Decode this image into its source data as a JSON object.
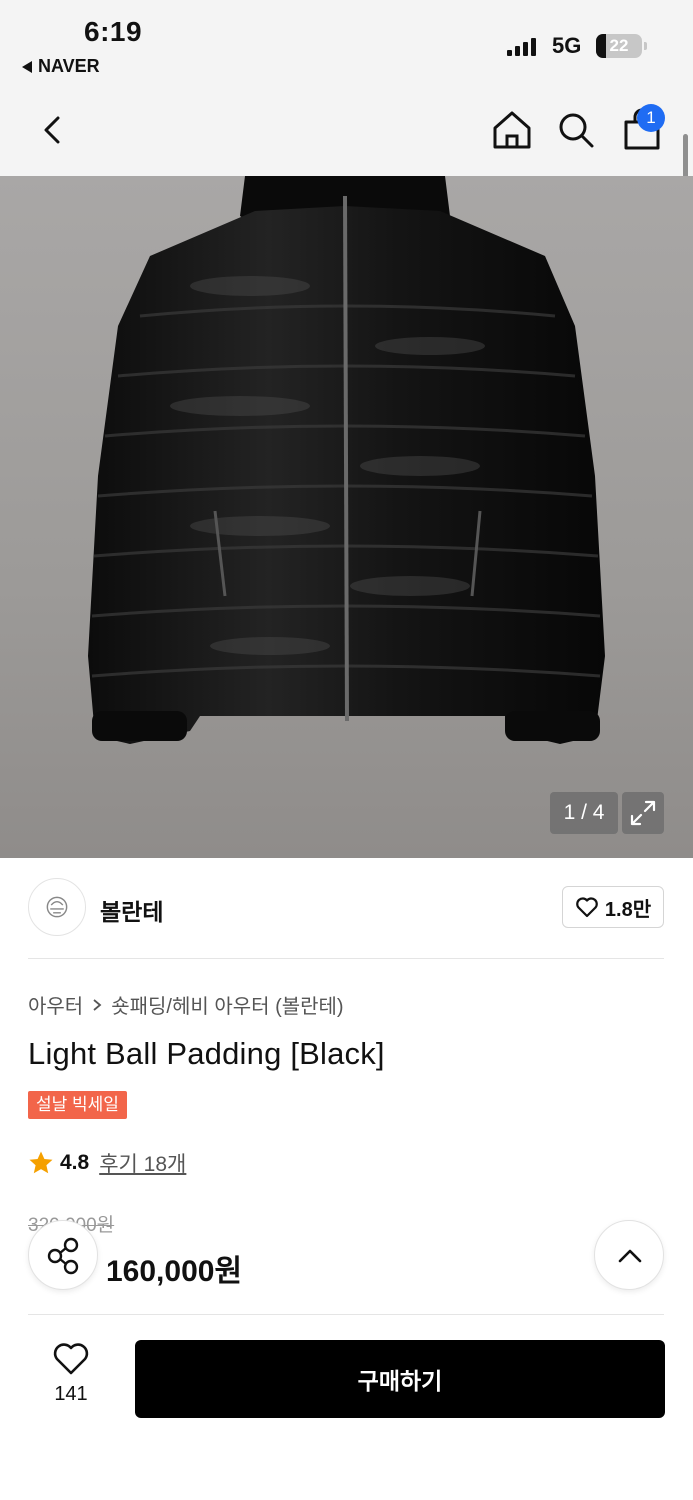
{
  "status_bar": {
    "time": "6:19",
    "back_app": "NAVER",
    "network": "5G",
    "battery": "22"
  },
  "nav": {
    "cart_count": "1"
  },
  "gallery": {
    "counter": "1 / 4"
  },
  "brand": {
    "name": "볼란테",
    "likes": "1.8만"
  },
  "product": {
    "breadcrumb_parent": "아우터",
    "breadcrumb_child": "숏패딩/헤비 아우터 (볼란테)",
    "title": "Light Ball Padding [Black]",
    "sale_tag": "설날 빅세일",
    "rating": "4.8",
    "reviews": "후기 18개",
    "original_price": "320,000원",
    "sale_price": "160,000원"
  },
  "bottom_bar": {
    "wish_count": "141",
    "buy_label": "구매하기"
  },
  "colors": {
    "accent": "#1f6cf3",
    "sale": "#f2654a",
    "star": "#f5a000"
  }
}
